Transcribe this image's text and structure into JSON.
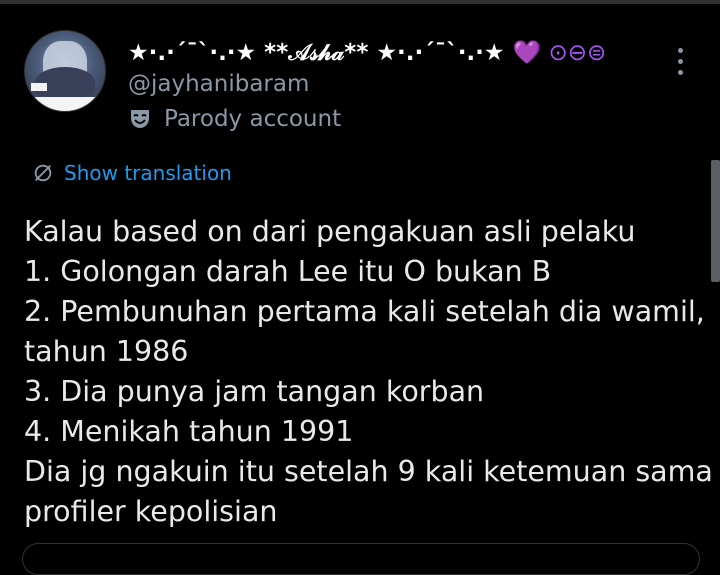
{
  "user": {
    "display_name": "★·.·´¯`·.·★ **𝒜𝓈𝒽𝒶** ★·.·´¯`·.·★",
    "name_badges": "💜 ⊙⊖⊜",
    "handle": "@jayhanibaram",
    "account_label": "Parody account",
    "avatar_tag": "Amikan"
  },
  "actions": {
    "more_icon": "more-vertical-icon",
    "translation_label": "Show translation",
    "translation_icon": "globe-icon"
  },
  "tweet": {
    "lines": [
      "Kalau based on dari pengakuan asli pelaku",
      "1. Golongan darah Lee itu O bukan B",
      "2. Pembunuhan pertama kali setelah dia wamil,",
      "tahun 1986",
      "3. Dia punya jam tangan korban",
      "4. Menikah tahun 1991",
      "Dia jg ngakuin itu setelah 9 kali ketemuan sama",
      "profiler kepolisian"
    ]
  },
  "colors": {
    "background": "#000000",
    "text": "#e7e9ea",
    "secondary_text": "#8b98a5",
    "link": "#1d9bf0",
    "heart": "#a855f7"
  }
}
